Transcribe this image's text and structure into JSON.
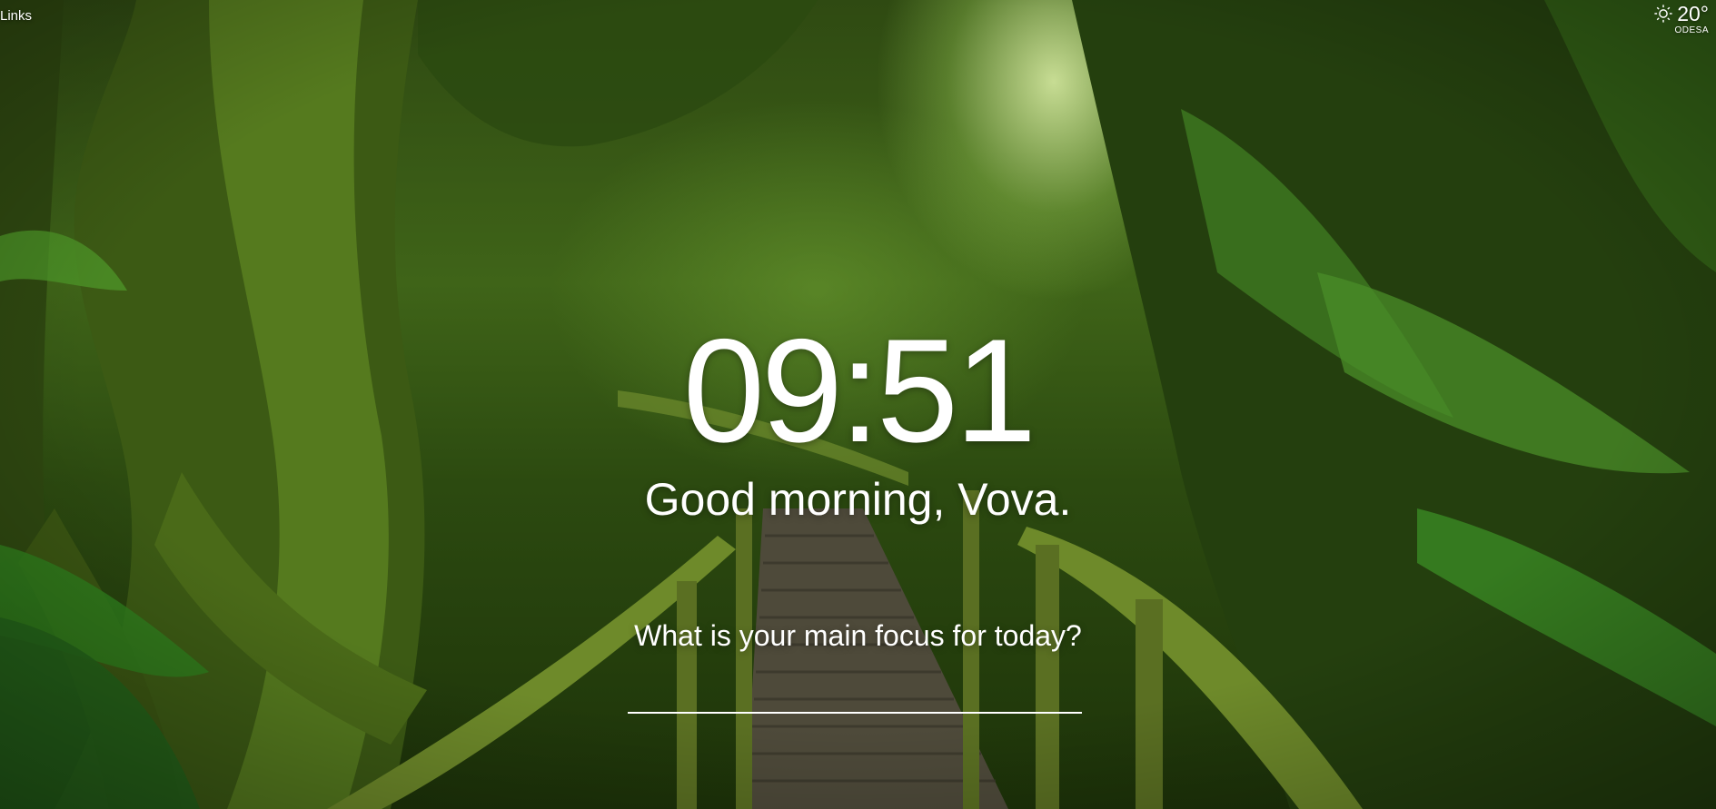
{
  "header": {
    "links_label": "Links"
  },
  "weather": {
    "icon": "sun-icon",
    "temperature": "20°",
    "location": "ODESA"
  },
  "main": {
    "time": "09:51",
    "greeting": "Good morning, Vova.",
    "focus_prompt": "What is your main focus for today?",
    "focus_value": ""
  }
}
